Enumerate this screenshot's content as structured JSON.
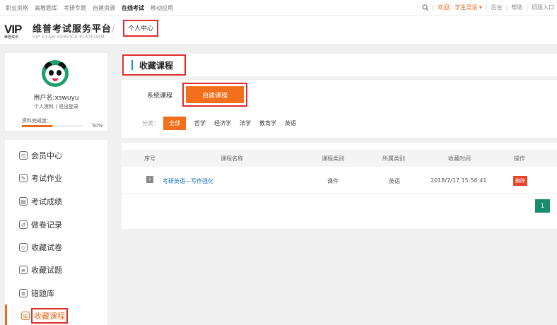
{
  "topbar": {
    "nav": [
      "职业资格",
      "高教题库",
      "考研专题",
      "自建资源",
      "在线考试",
      "移动应用"
    ],
    "active_index": 4,
    "welcome": "欢迎：学生吴语 ▾",
    "links": [
      "后台",
      "帮助",
      "旧版入口"
    ]
  },
  "header": {
    "logo_mark": "VIP",
    "logo_sub": "维普资讯",
    "logo_title": "维普考试服务平台",
    "logo_subtitle": "VIP EXAM SERVICE PLATFORM",
    "breadcrumb_sep": "/",
    "breadcrumb": "个人中心"
  },
  "profile": {
    "username": "用户名:xswuyu",
    "link_profile": "个人资料",
    "link_sep": "|",
    "link_logout": "退出登录",
    "completion_label": "资料完成度：",
    "completion_value": "50%",
    "completion_fraction": 0.5
  },
  "menu": {
    "items": [
      {
        "label": "会员中心",
        "icon": "member-icon",
        "glyph": "⊙"
      },
      {
        "label": "考试作业",
        "icon": "homework-icon",
        "glyph": "✎"
      },
      {
        "label": "考试成绩",
        "icon": "score-icon",
        "glyph": "▤"
      },
      {
        "label": "做卷记录",
        "icon": "history-icon",
        "glyph": "↺"
      },
      {
        "label": "收藏试卷",
        "icon": "paper-fav-icon",
        "glyph": "◇"
      },
      {
        "label": "收藏试题",
        "icon": "question-fav-icon",
        "glyph": "≡"
      },
      {
        "label": "错题库",
        "icon": "wrong-bank-icon",
        "glyph": "≣"
      },
      {
        "label": "收藏课程",
        "icon": "course-fav-icon",
        "glyph": "⊞"
      }
    ],
    "active_index": 7
  },
  "main": {
    "title": "收藏课程",
    "tabs": [
      "系统课程",
      "自建课程"
    ],
    "active_tab": 1,
    "category_label": "分类：",
    "categories": [
      "全部",
      "哲学",
      "经济学",
      "法学",
      "教育学",
      "英语"
    ],
    "active_category": 0
  },
  "table": {
    "headers": [
      "序号",
      "课程名称",
      "课程类别",
      "所属类别",
      "收藏时间",
      "操作"
    ],
    "rows": [
      {
        "index_icon": "I",
        "name": "考研英语—写作强化",
        "type": "课件",
        "category": "英语",
        "time": "2018/7/17 15:56:41",
        "action": "删除"
      }
    ]
  },
  "pagination": {
    "page": "1"
  },
  "colors": {
    "accent": "#f36f1b",
    "highlight": "#e12b2b",
    "page": "#1b8b6e",
    "link": "#1a6fbf"
  }
}
